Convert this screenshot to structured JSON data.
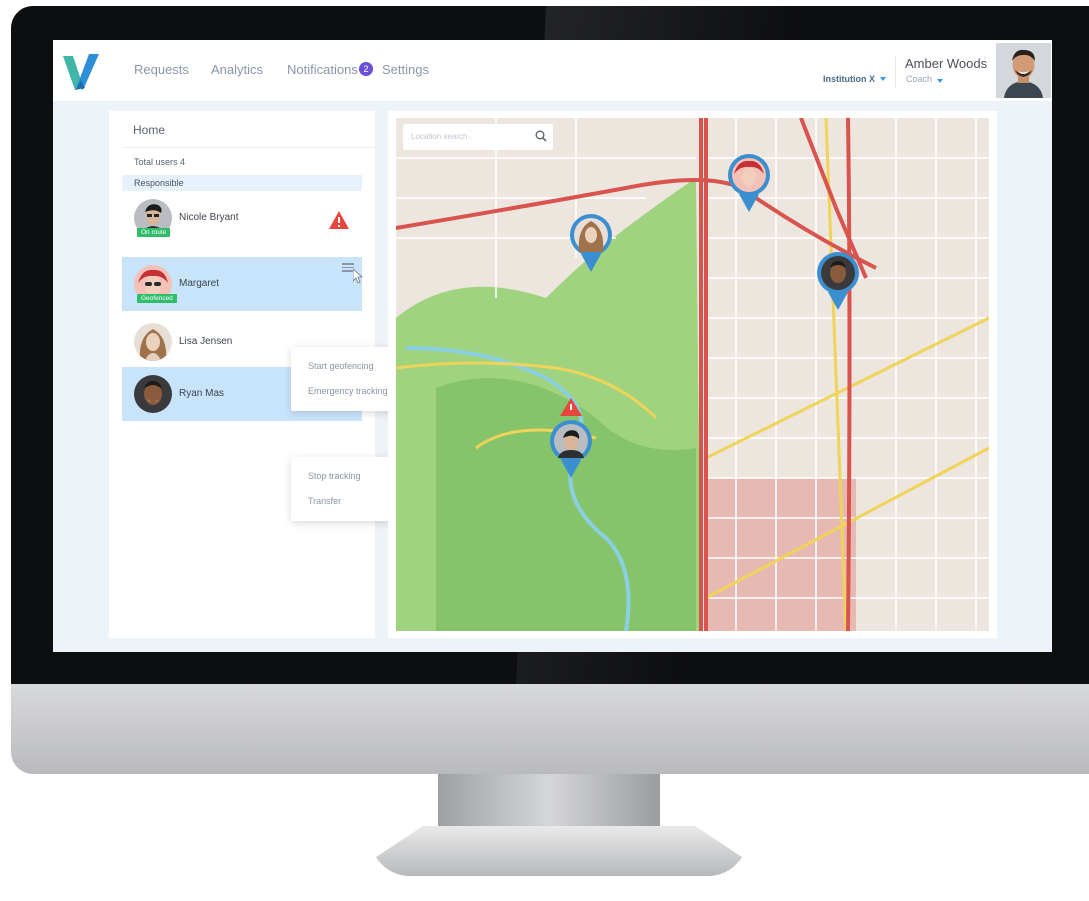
{
  "nav": {
    "requests": "Requests",
    "analytics": "Analytics",
    "notifications": "Notifications",
    "notifications_count": "2",
    "settings": "Settings"
  },
  "institution": {
    "label": "Institution X"
  },
  "user": {
    "name": "Amber Woods",
    "role": "Coach"
  },
  "panel": {
    "title": "Home",
    "total_users": "Total users 4",
    "section": "Responsible",
    "items": [
      {
        "name": "Nicole Bryant",
        "status": "On route",
        "alert": true
      },
      {
        "name": "Margaret",
        "status": "Geofenced"
      },
      {
        "name": "Lisa Jensen"
      },
      {
        "name": "Ryan Mas"
      }
    ],
    "menu_margaret": [
      "Start geofencing",
      "Emergency tracking"
    ],
    "menu_ryan": [
      "Stop tracking",
      "Transfer"
    ]
  },
  "map": {
    "search_placeholder": "Location search"
  },
  "colors": {
    "accent": "#2c9be8",
    "badge": "#6b4fd6",
    "selected_row": "#c7e4fb",
    "status_green": "#2fbd6a",
    "alert_red": "#e8453c",
    "park_green": "#7cc576",
    "road_red": "#d9534f",
    "road_yellow": "#f0d35a",
    "pin_blue": "#3b8fd0"
  }
}
